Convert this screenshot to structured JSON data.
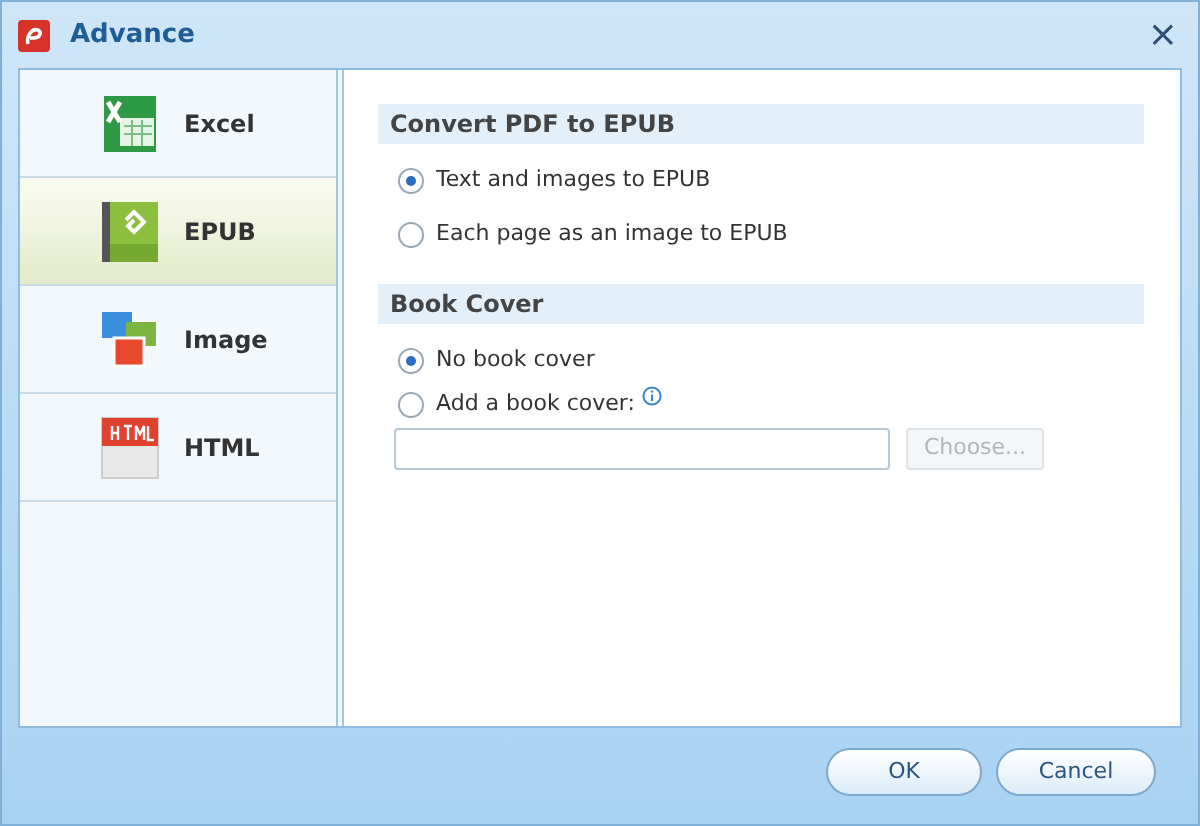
{
  "window": {
    "title": "Advance",
    "close": "×"
  },
  "sidebar": {
    "items": [
      {
        "label": "Excel",
        "kind": "excel",
        "selected": false
      },
      {
        "label": "EPUB",
        "kind": "epub",
        "selected": true
      },
      {
        "label": "Image",
        "kind": "image",
        "selected": false
      },
      {
        "label": "HTML",
        "kind": "html",
        "selected": false
      }
    ]
  },
  "sections": [
    {
      "title": "Convert PDF to EPUB",
      "options": [
        {
          "label": "Text and images to EPUB",
          "checked": true
        },
        {
          "label": "Each page as an image to EPUB",
          "checked": false
        }
      ]
    },
    {
      "title": "Book Cover",
      "options": [
        {
          "label": "No book cover",
          "checked": true
        },
        {
          "label": "Add a book cover:",
          "checked": false,
          "info": true
        }
      ],
      "choose_button": {
        "label": "Choose...",
        "disabled": true
      }
    }
  ],
  "buttons": [
    "OK",
    "Cancel"
  ]
}
